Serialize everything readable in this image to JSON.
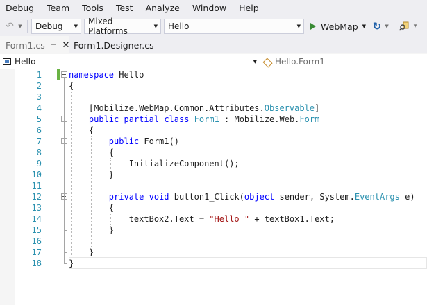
{
  "menu": [
    "Debug",
    "Team",
    "Tools",
    "Test",
    "Analyze",
    "Window",
    "Help"
  ],
  "toolbar": {
    "configuration": "Debug",
    "platform": "Mixed Platforms",
    "project": "Hello",
    "run_target": "WebMap"
  },
  "tabs": [
    {
      "label": "Form1.cs",
      "active": true
    },
    {
      "label": "Form1.Designer.cs",
      "active": false
    }
  ],
  "navbar": {
    "left": "Hello",
    "right": "Hello.Form1"
  },
  "editor": {
    "lines": [
      {
        "n": "1",
        "tokens": [
          {
            "t": "namespace",
            "c": "kw"
          },
          {
            "t": " Hello"
          }
        ]
      },
      {
        "n": "2",
        "tokens": [
          {
            "t": "{"
          }
        ]
      },
      {
        "n": "3",
        "tokens": []
      },
      {
        "n": "4",
        "tokens": [
          {
            "t": "    [Mobilize.WebMap.Common.Attributes."
          },
          {
            "t": "Observable",
            "c": "ty"
          },
          {
            "t": "]"
          }
        ]
      },
      {
        "n": "5",
        "tokens": [
          {
            "t": "    "
          },
          {
            "t": "public",
            "c": "kw"
          },
          {
            "t": " "
          },
          {
            "t": "partial",
            "c": "kw"
          },
          {
            "t": " "
          },
          {
            "t": "class",
            "c": "kw"
          },
          {
            "t": " "
          },
          {
            "t": "Form1",
            "c": "ty"
          },
          {
            "t": " : Mobilize.Web."
          },
          {
            "t": "Form",
            "c": "ty"
          }
        ]
      },
      {
        "n": "6",
        "tokens": [
          {
            "t": "    {"
          }
        ]
      },
      {
        "n": "7",
        "tokens": [
          {
            "t": "        "
          },
          {
            "t": "public",
            "c": "kw"
          },
          {
            "t": " Form1()"
          }
        ]
      },
      {
        "n": "8",
        "tokens": [
          {
            "t": "        {"
          }
        ]
      },
      {
        "n": "9",
        "tokens": [
          {
            "t": "            InitializeComponent();"
          }
        ]
      },
      {
        "n": "10",
        "tokens": [
          {
            "t": "        }"
          }
        ]
      },
      {
        "n": "11",
        "tokens": []
      },
      {
        "n": "12",
        "tokens": [
          {
            "t": "        "
          },
          {
            "t": "private",
            "c": "kw"
          },
          {
            "t": " "
          },
          {
            "t": "void",
            "c": "kw"
          },
          {
            "t": " button1_Click("
          },
          {
            "t": "object",
            "c": "kw"
          },
          {
            "t": " sender, System."
          },
          {
            "t": "EventArgs",
            "c": "ty"
          },
          {
            "t": " e)"
          }
        ]
      },
      {
        "n": "13",
        "tokens": [
          {
            "t": "        {"
          }
        ]
      },
      {
        "n": "14",
        "tokens": [
          {
            "t": "            textBox2.Text = "
          },
          {
            "t": "\"Hello \"",
            "c": "st"
          },
          {
            "t": " + textBox1.Text;"
          }
        ]
      },
      {
        "n": "15",
        "tokens": [
          {
            "t": "        }"
          }
        ]
      },
      {
        "n": "16",
        "tokens": []
      },
      {
        "n": "17",
        "tokens": [
          {
            "t": "    }"
          }
        ]
      },
      {
        "n": "18",
        "tokens": [
          {
            "t": "}"
          }
        ]
      }
    ],
    "fold_lines": [
      "1",
      "5",
      "7",
      "12"
    ]
  }
}
